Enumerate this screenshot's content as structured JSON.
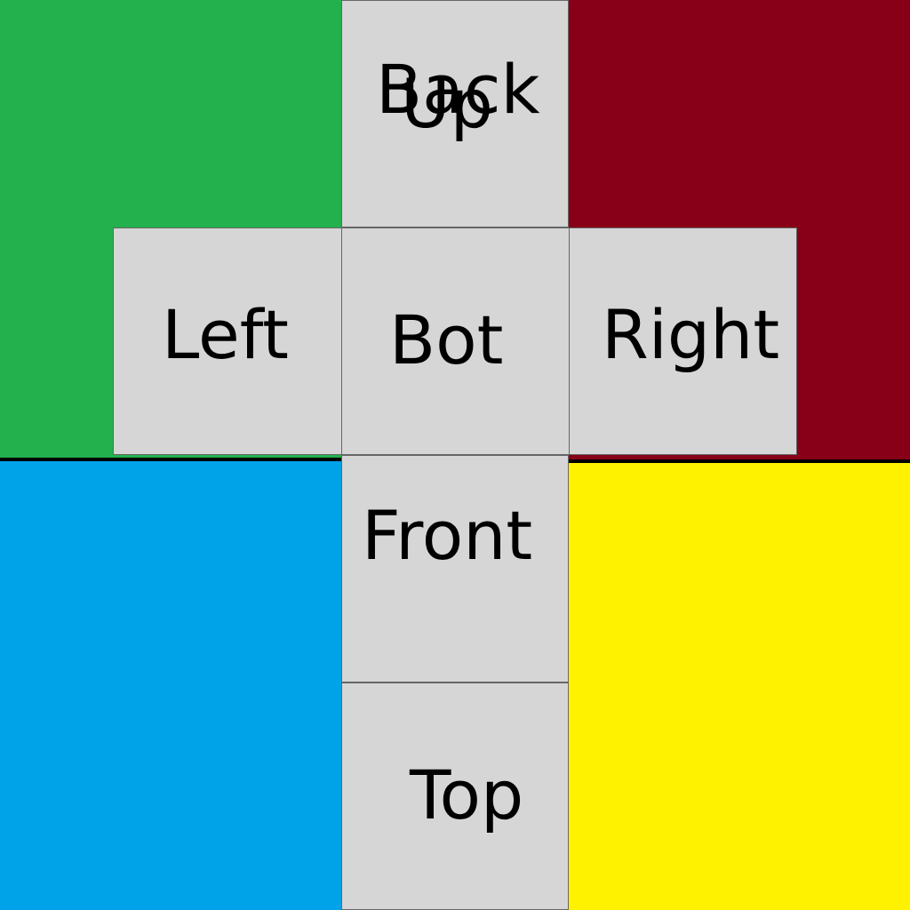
{
  "colors": {
    "top_left_quadrant": "#22b14c",
    "top_right_quadrant": "#880018",
    "bottom_left_quadrant": "#00a2e8",
    "bottom_right_quadrant": "#fff200",
    "face_fill": "#d6d6d6",
    "divider": "#000000"
  },
  "faces": {
    "back": "Back",
    "up": "Up",
    "left": "Left",
    "bot": "Bot",
    "right": "Right",
    "front": "Front",
    "top": "Top"
  }
}
